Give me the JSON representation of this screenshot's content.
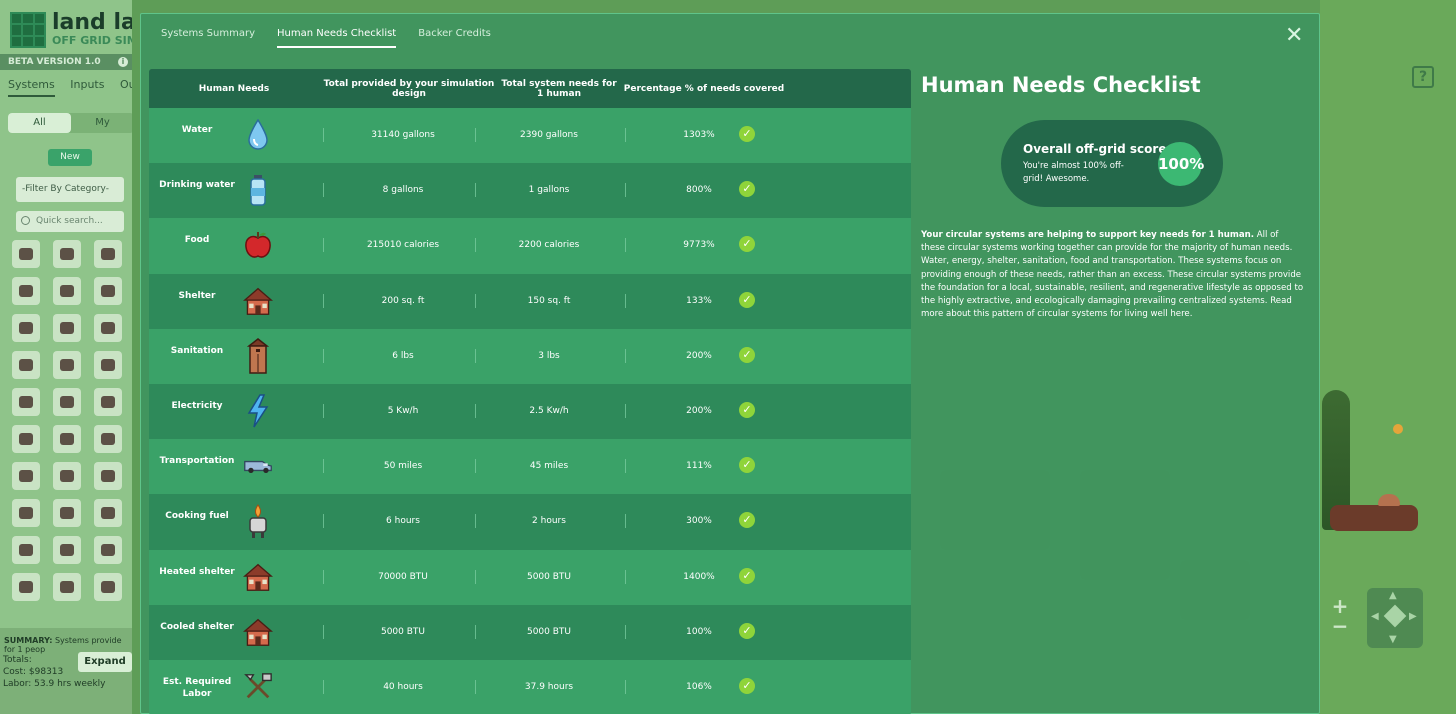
{
  "sidebar": {
    "logo_title": "land lab",
    "logo_subtitle": "OFF GRID SIM",
    "version": "BETA VERSION 1.0",
    "tabs": [
      "Systems",
      "Inputs",
      "Outputs"
    ],
    "segment": [
      "All",
      "My"
    ],
    "new_label": "New",
    "filter_placeholder": "-Filter By Category-",
    "search_placeholder": "Quick search...",
    "summary_label": "SUMMARY:",
    "summary_text": "Systems provide for 1 peop",
    "totals_label": "Totals:",
    "cost": "Cost: $98313",
    "labor": "Labor: 53.9 hrs weekly",
    "expand_label": "Expand"
  },
  "modal": {
    "tabs": [
      "Systems Summary",
      "Human Needs Checklist",
      "Backer Credits"
    ],
    "active_tab": "Human Needs Checklist",
    "close_symbol": "✕",
    "table": {
      "headers": [
        "Human Needs",
        "Total provided by your simulation design",
        "Total system needs for 1 human",
        "Percentage % of needs covered"
      ],
      "rows": [
        {
          "need": "Water",
          "icon": "water-drop-icon",
          "provided": "31140 gallons",
          "needed": "2390 gallons",
          "percent": "1303%"
        },
        {
          "need": "Drinking water",
          "icon": "water-bottle-icon",
          "provided": "8 gallons",
          "needed": "1 gallons",
          "percent": "800%"
        },
        {
          "need": "Food",
          "icon": "apple-icon",
          "provided": "215010 calories",
          "needed": "2200 calories",
          "percent": "9773%"
        },
        {
          "need": "Shelter",
          "icon": "house-icon",
          "provided": "200 sq. ft",
          "needed": "150 sq. ft",
          "percent": "133%"
        },
        {
          "need": "Sanitation",
          "icon": "outhouse-icon",
          "provided": "6 lbs",
          "needed": "3 lbs",
          "percent": "200%"
        },
        {
          "need": "Electricity",
          "icon": "lightning-icon",
          "provided": "5 Kw/h",
          "needed": "2.5 Kw/h",
          "percent": "200%"
        },
        {
          "need": "Transportation",
          "icon": "van-icon",
          "provided": "50 miles",
          "needed": "45 miles",
          "percent": "111%"
        },
        {
          "need": "Cooking fuel",
          "icon": "stove-icon",
          "provided": "6 hours",
          "needed": "2 hours",
          "percent": "300%"
        },
        {
          "need": "Heated shelter",
          "icon": "house-icon",
          "provided": "70000 BTU",
          "needed": "5000 BTU",
          "percent": "1400%"
        },
        {
          "need": "Cooled shelter",
          "icon": "house-icon",
          "provided": "5000 BTU",
          "needed": "5000 BTU",
          "percent": "100%"
        },
        {
          "need": "Est. Required Labor",
          "icon": "tools-icon",
          "provided": "40 hours",
          "needed": "37.9 hours",
          "percent": "106%"
        }
      ]
    },
    "panel": {
      "title": "Human Needs Checklist",
      "score_title": "Overall off-grid score:",
      "score_subtitle": "You're almost 100% off-grid! Awesome.",
      "score_value": "100%",
      "desc_bold": "Your circular systems are helping to support key needs for 1 human.",
      "desc_text": " All of these circular systems working together can provide for the majority of human needs. Water, energy, shelter, sanitation, food and transportation. These systems focus on providing enough of these needs, rather than an excess. These circular systems provide the foundation for a local, sustainable, resilient, and regenerative lifestyle as opposed to the highly extractive, and ecologically damaging prevailing centralized systems. Read more about this pattern of circular systems for living well here."
    }
  },
  "map": {
    "help_symbol": "?",
    "zoom_in": "+",
    "zoom_out": "−"
  },
  "colors": {
    "modal_bg": "#3f945f",
    "header_bg": "#23684a",
    "row_light": "#3aa268",
    "row_dark": "#2e8a5a",
    "check": "#8fd43a"
  }
}
